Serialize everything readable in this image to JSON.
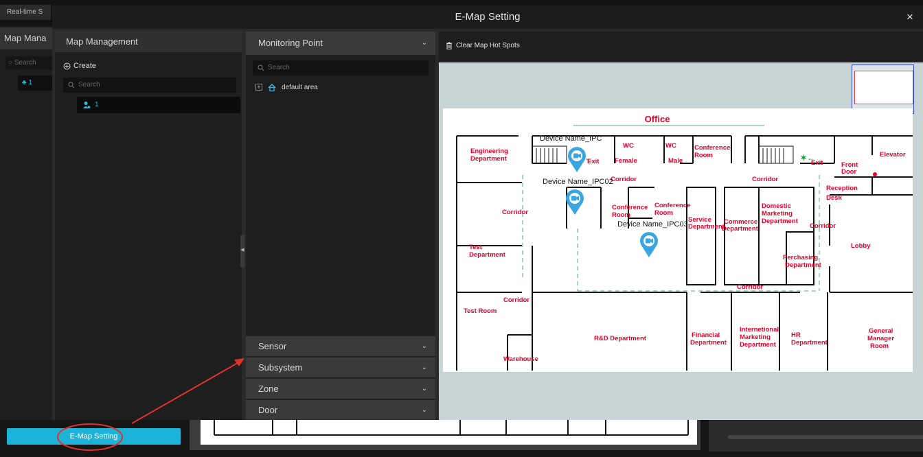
{
  "background": {
    "tab_label": "Real-time S",
    "left_panel_title": "Map Mana",
    "search_placeholder": "Search",
    "tree_item": "1",
    "emap_button": "E-Map Setting"
  },
  "dialog": {
    "title": "E-Map Setting",
    "close_icon": "×",
    "map_management": {
      "header": "Map Management",
      "create_label": "Create",
      "search_placeholder": "Search",
      "items": [
        {
          "label": "1"
        }
      ]
    },
    "monitoring_point": {
      "header": "Monitoring Point",
      "search_placeholder": "Search",
      "tree": [
        {
          "label": "default area"
        }
      ]
    },
    "accordions": [
      {
        "label": "Sensor"
      },
      {
        "label": "Subsystem"
      },
      {
        "label": "Zone"
      },
      {
        "label": "Door"
      }
    ],
    "toolbar": {
      "clear_label": "Clear Map Hot Spots"
    },
    "map": {
      "title": "Office",
      "devices": [
        {
          "name": "Device Name_IPC"
        },
        {
          "name": "Device Name_IPC02"
        },
        {
          "name": "Device Name_IPC03"
        }
      ],
      "rooms": [
        "Engineering Department",
        "WC Female",
        "WC Male",
        "Conference Room",
        "Elevator",
        "Front Door",
        "Exit",
        "Corridor",
        "Reception Desk",
        "Conference Room",
        "Service Department",
        "Commerce Department",
        "Domestic Marketing Department",
        "Lobby",
        "Test Department",
        "Perchasing Department",
        "Test Room",
        "R&D Department",
        "Financial Department",
        "Internetional Marketing Department",
        "HR Department",
        "General Manager Room",
        "Warehouse"
      ]
    }
  },
  "colors": {
    "accent": "#1db3d8",
    "pin": "#3aa6e0",
    "room_label": "#e8002a",
    "corridor_dash": "#4caf80",
    "annotation": "#e0322b"
  }
}
